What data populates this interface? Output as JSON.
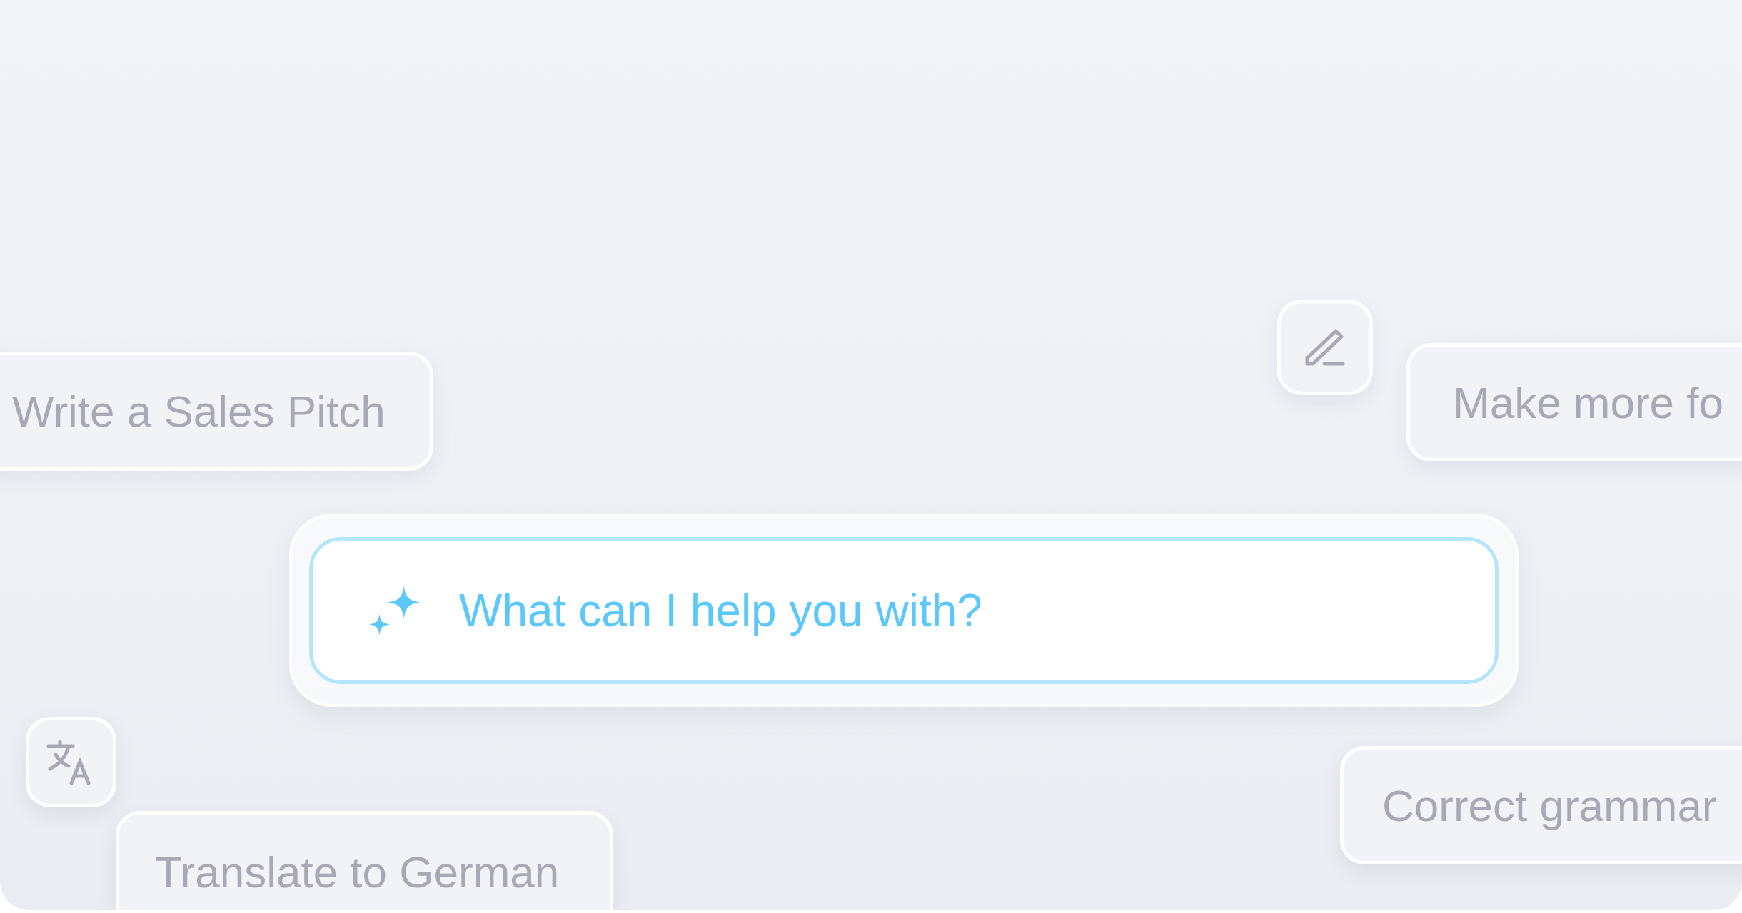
{
  "suggestions": [
    {
      "label": "Write a Sales Pitch"
    },
    {
      "label": "Make more fo"
    },
    {
      "label": "Correct grammar"
    },
    {
      "label": "Translate to German"
    }
  ],
  "prompt": {
    "placeholder": "What can I help you with?"
  }
}
